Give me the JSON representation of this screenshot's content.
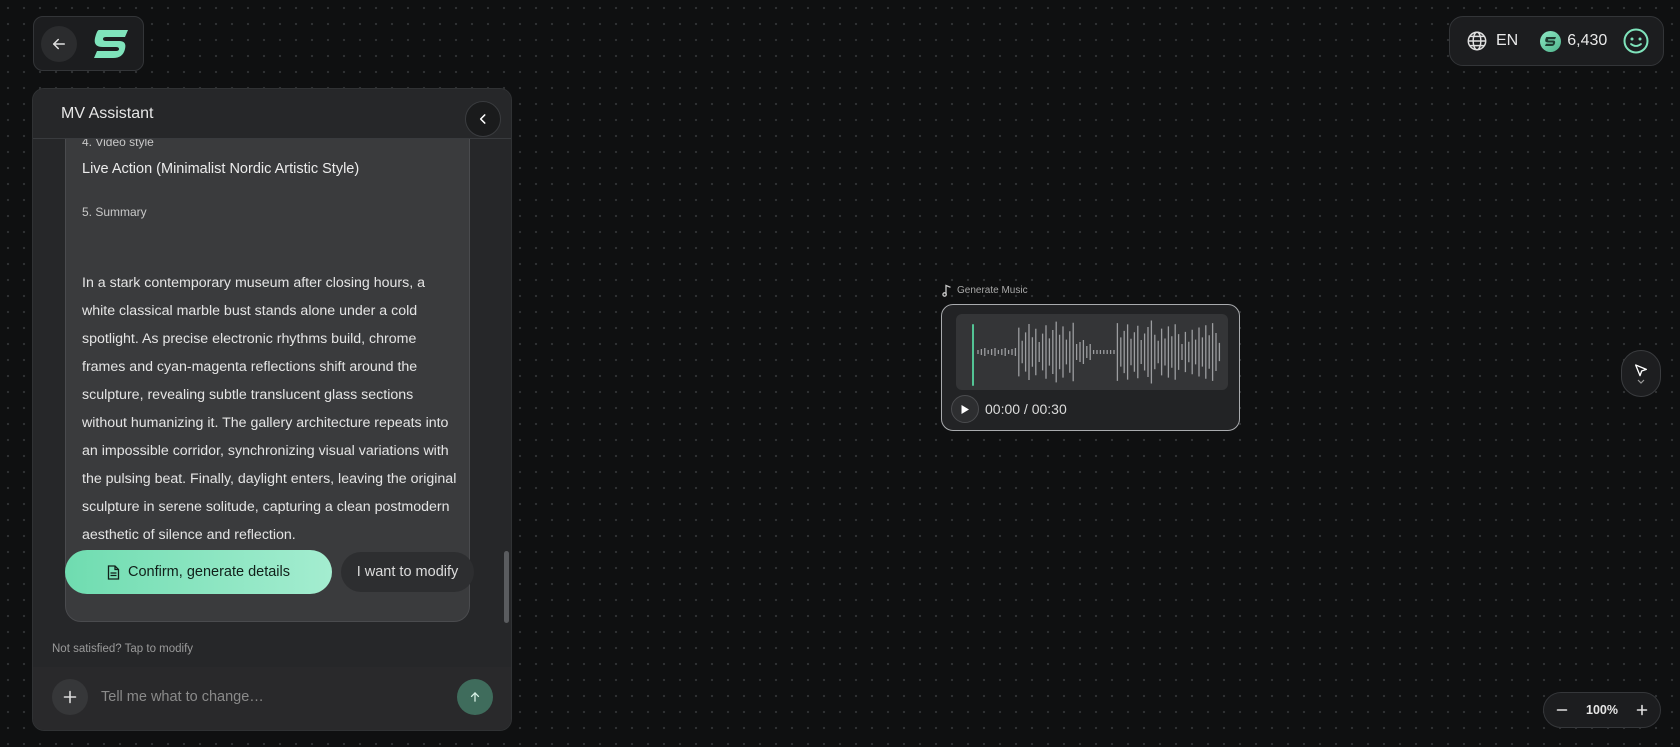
{
  "topbar": {
    "back_icon": "arrow-left-icon",
    "logo_icon": "brand-logo",
    "language": "EN",
    "credits": "6,430",
    "accent": "#6fdcb0"
  },
  "panel": {
    "title": "MV Assistant",
    "sections": [
      {
        "label": "4. Video style",
        "value": "Live Action (Minimalist Nordic Artistic Style)"
      },
      {
        "label": "5. Summary",
        "value": "In a stark contemporary museum after closing hours, a white classical marble bust stands alone under a cold spotlight. As precise electronic rhythms build, chrome frames and cyan-magenta reflections shift around the sculpture, revealing subtle translucent glass sections without humanizing it. The gallery architecture repeats into an impossible corridor, synchronizing visual variations with the pulsing beat. Finally, daylight enters, leaving the original sculpture in serene solitude, capturing a clean postmodern aesthetic of silence and reflection."
      }
    ],
    "confirm_label": "Confirm, generate details",
    "modify_label": "I want to modify",
    "hint": "Not satisfied? Tap to modify",
    "input_placeholder": "Tell me what to change…"
  },
  "music_node": {
    "label": "Generate Music",
    "time": "00:00 / 00:30",
    "progress": 0
  },
  "zoom": {
    "level": "100%"
  }
}
